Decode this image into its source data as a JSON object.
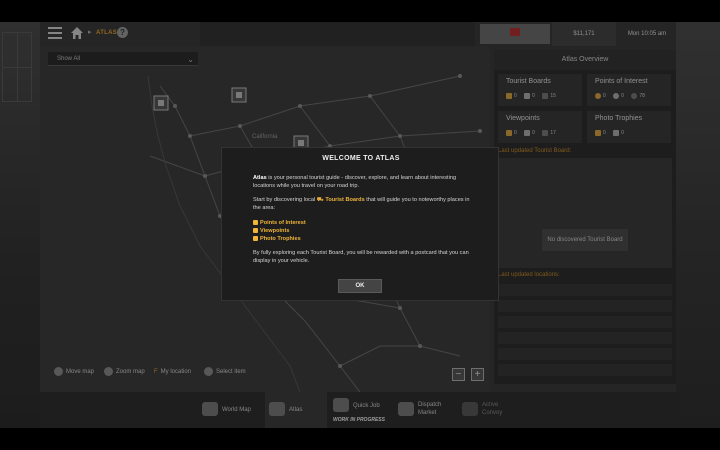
{
  "topbar": {
    "breadcrumb": "ATLAS",
    "help_symbol": "?",
    "money": "$11,171",
    "time": "Mon 10:05 am"
  },
  "map": {
    "filter": {
      "selected": "Show All"
    },
    "state_label": "California",
    "controls": [
      {
        "label": "Move map",
        "icon": "mouse-drag-icon"
      },
      {
        "label": "Zoom map",
        "icon": "mouse-wheel-icon"
      },
      {
        "label": "My location",
        "icon": "key-f-icon",
        "key": "F"
      },
      {
        "label": "Select item",
        "icon": "mouse-click-icon"
      }
    ],
    "zoom_out": "−",
    "zoom_in": "+"
  },
  "panel": {
    "title": "Atlas Overview",
    "cards": [
      {
        "title": "Tourist Boards",
        "values": [
          "0",
          "0",
          "15"
        ]
      },
      {
        "title": "Points of Interest",
        "values": [
          "0",
          "0",
          "78"
        ]
      },
      {
        "title": "Viewpoints",
        "values": [
          "0",
          "0",
          "17"
        ]
      },
      {
        "title": "Photo Trophies",
        "values": [
          "0",
          "0"
        ]
      }
    ],
    "last_board_title": "Last updated Tourist Board:",
    "no_board": "No discovered Tourist Board",
    "last_locations_title": "Last updated locations:"
  },
  "bottomnav": {
    "items": [
      {
        "label": "World Map"
      },
      {
        "label": "Atlas"
      },
      {
        "label": "Quick Job",
        "sub": "WORK IN PROGRESS"
      },
      {
        "label": "Dispatch\nMarket"
      },
      {
        "label": "Active\nConvoy"
      }
    ]
  },
  "modal": {
    "title": "WELCOME TO ATLAS",
    "intro_bold": "Atlas",
    "intro_rest": " is your personal tourist guide - discover, explore, and learn about interesting locations while you travel on your road trip.",
    "start_pre": "Start by discovering local ",
    "start_hl": "Tourist Boards",
    "start_post": " that will guide you to noteworthy places in the area:",
    "items": [
      "Points of Interest",
      "Viewpoints",
      "Photo Trophies"
    ],
    "outro": "By fully exploring each Tourist Board, you will be rewarded with a postcard that you can display in your vehicle.",
    "ok": "OK"
  },
  "colors": {
    "accent": "#f0b43a",
    "section_title": "#c58a2a",
    "flag": "#b03030"
  }
}
